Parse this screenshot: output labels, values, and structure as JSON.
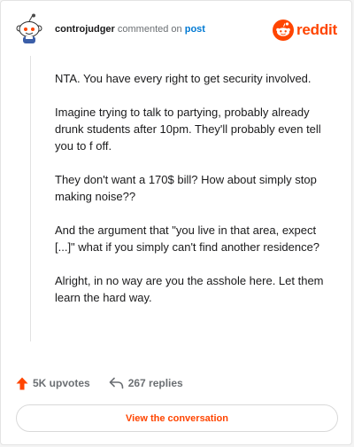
{
  "header": {
    "username": "controjudger",
    "action_text": "commented on",
    "link_text": "post",
    "brand_wordmark": "reddit"
  },
  "comment": {
    "paragraphs": [
      "NTA. You have every right to get security involved.",
      "Imagine trying to talk to partying, probably already drunk students after 10pm. They'll probably even tell you to f off.",
      "They don't want a 170$ bill? How about simply stop making noise??",
      "And the argument that \"you live in that area, expect [...]\" what if you simply can't find another residence?",
      "Alright, in no way are you the asshole here. Let them learn the hard way."
    ]
  },
  "actions": {
    "upvotes_label": "5K upvotes",
    "replies_label": "267 replies"
  },
  "cta": {
    "label": "View the conversation"
  },
  "icons": {
    "avatar": "snoo-avatar-icon",
    "brand": "reddit-logo-icon",
    "upvote": "upvote-arrow-icon",
    "reply": "reply-arrow-icon"
  },
  "colors": {
    "brand": "#ff4500",
    "link": "#0079d3",
    "text": "#1a1a1b",
    "muted": "#6b6f73"
  }
}
